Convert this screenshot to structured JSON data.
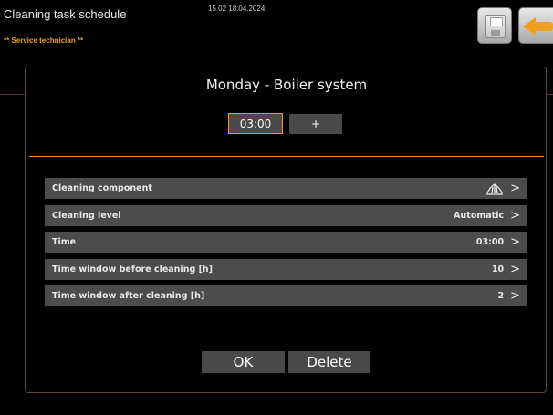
{
  "header": {
    "title": "Cleaning task schedule",
    "role": "** Service technician **",
    "datetime": "15 02 18.04.2024",
    "save_icon": "save-icon",
    "back_icon": "back-arrow-icon"
  },
  "dialog": {
    "title": "Monday - Boiler system",
    "time_value": "03:00",
    "plus_label": "+",
    "rows": [
      {
        "label": "Cleaning component",
        "value": "",
        "icon": "cleaning-component-icon"
      },
      {
        "label": "Cleaning level",
        "value": "Automatic"
      },
      {
        "label": "Time",
        "value": "03:00"
      },
      {
        "label": "Time window before cleaning [h]",
        "value": "10"
      },
      {
        "label": "Time window after cleaning [h]",
        "value": "2"
      }
    ],
    "chevron": ">",
    "ok_label": "OK",
    "delete_label": "Delete"
  },
  "colors": {
    "accent": "#f0a020",
    "row_bg": "#4c4c4c",
    "background": "#000000"
  }
}
